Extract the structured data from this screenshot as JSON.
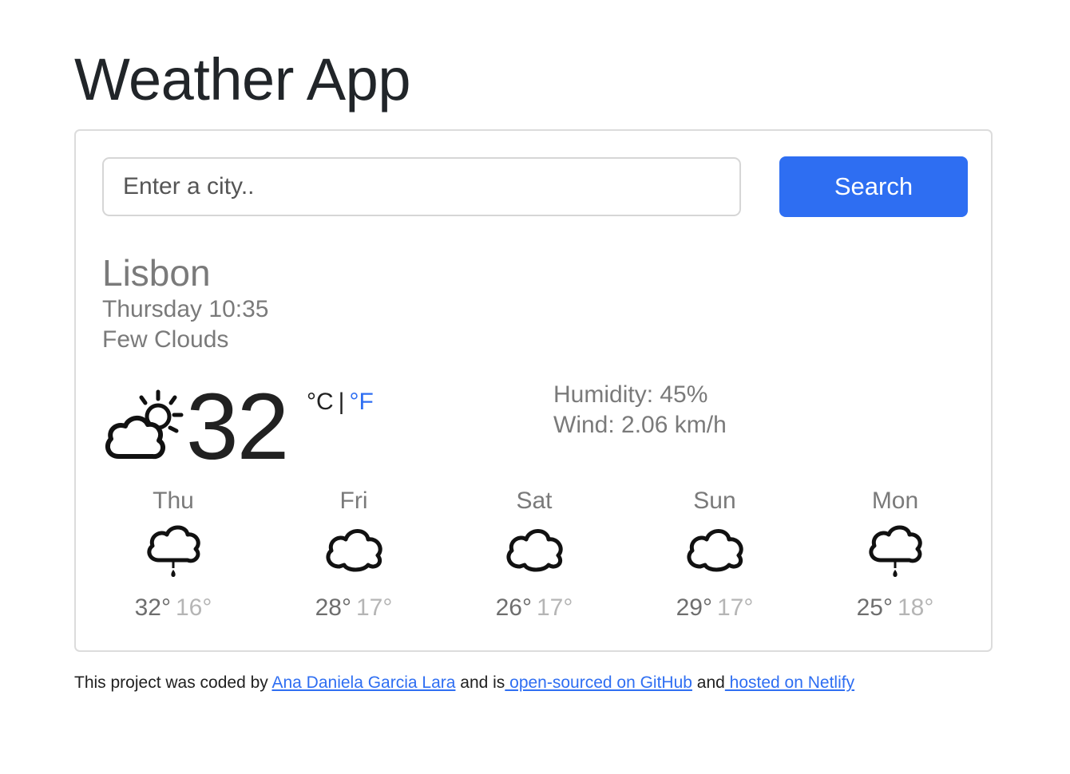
{
  "header": {
    "title": "Weather App"
  },
  "search": {
    "placeholder": "Enter a city..",
    "value": "",
    "button_label": "Search"
  },
  "current": {
    "city": "Lisbon",
    "date_time": "Thursday 10:35",
    "description": "Few Clouds",
    "icon": "partly-cloudy-icon",
    "temperature": "32",
    "unit_celsius": "°C",
    "unit_separator": "|",
    "unit_fahrenheit": "°F",
    "humidity": "Humidity: 45%",
    "wind": "Wind: 2.06 km/h"
  },
  "forecast": [
    {
      "day": "Thu",
      "icon": "rain-cloud-icon",
      "max": "32°",
      "min": "16°"
    },
    {
      "day": "Fri",
      "icon": "cloud-icon",
      "max": "28°",
      "min": "17°"
    },
    {
      "day": "Sat",
      "icon": "cloud-icon",
      "max": "26°",
      "min": "17°"
    },
    {
      "day": "Sun",
      "icon": "cloud-icon",
      "max": "29°",
      "min": "17°"
    },
    {
      "day": "Mon",
      "icon": "rain-cloud-icon",
      "max": "25°",
      "min": "18°"
    }
  ],
  "footer": {
    "text_1": "This project was coded by ",
    "author_link": "Ana Daniela Garcia Lara",
    "text_2": " and is",
    "github_link": " open-sourced on GitHub",
    "text_3": " and",
    "netlify_link": " hosted on Netlify"
  },
  "colors": {
    "accent": "#2e6ef2",
    "text_dark": "#212121",
    "text_muted": "#7a7a7a",
    "text_light": "#b5b5b5",
    "border": "#dcdcdc"
  }
}
